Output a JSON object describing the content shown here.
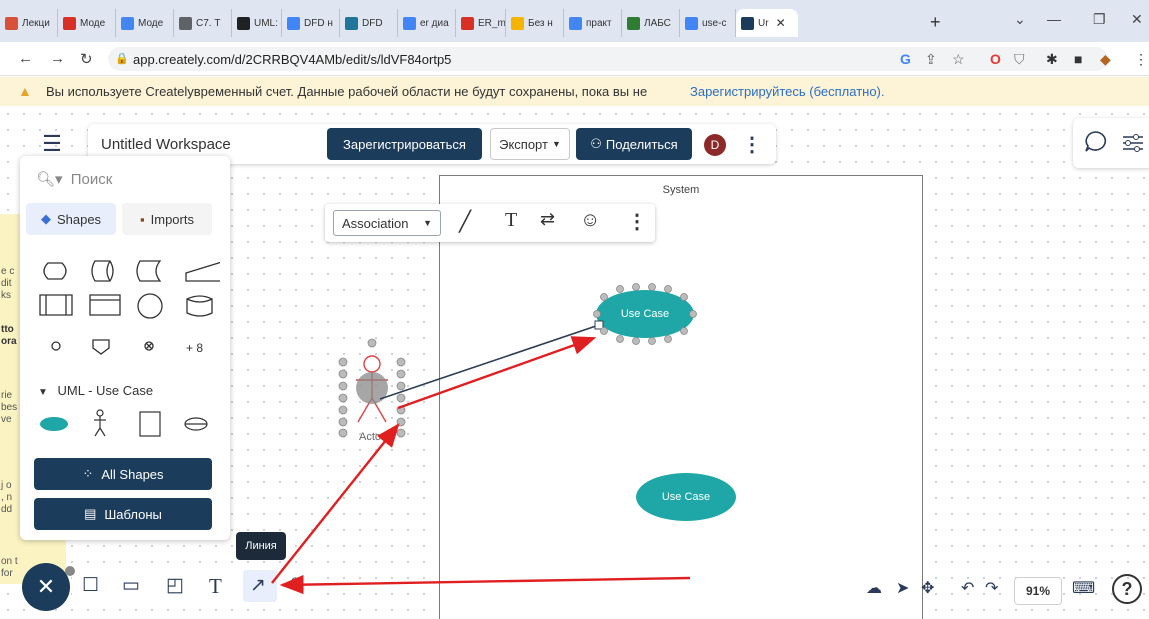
{
  "browser": {
    "tabs": [
      {
        "label": "Лекци",
        "icon": "red-diamond-icon",
        "color": "#d8523b"
      },
      {
        "label": "Моде",
        "icon": "pdf-icon",
        "color": "#d93025"
      },
      {
        "label": "Моде",
        "icon": "google-icon",
        "color": "#4285f4"
      },
      {
        "label": "С7. Т",
        "icon": "globe-icon",
        "color": "#5f6368"
      },
      {
        "label": "UML:",
        "icon": "app-icon",
        "color": "#202124"
      },
      {
        "label": "DFD н",
        "icon": "google-icon",
        "color": "#4285f4"
      },
      {
        "label": "DFD",
        "icon": "wordpress-icon",
        "color": "#21759b"
      },
      {
        "label": "er диа",
        "icon": "google-icon",
        "color": "#4285f4"
      },
      {
        "label": "ER_m",
        "icon": "pdf-icon",
        "color": "#d93025"
      },
      {
        "label": "Без н",
        "icon": "loading-icon",
        "color": "#f4b400"
      },
      {
        "label": "практ",
        "icon": "google-icon",
        "color": "#4285f4"
      },
      {
        "label": "ЛАБС",
        "icon": "doc-icon",
        "color": "#2f7d32"
      },
      {
        "label": "use-c",
        "icon": "google-icon",
        "color": "#4285f4"
      },
      {
        "label": "Ur",
        "icon": "creately-icon",
        "color": "#1c3c5c",
        "active": true
      }
    ],
    "url": "app.creately.com/d/2CRRBQV4AMb/edit/s/ldVF84ortp5"
  },
  "warning": {
    "message": "Вы используете Createlyвременный счет. Данные рабочей области не будут сохранены, пока вы не",
    "link": "Зарегистрируйтесь (бесплатно)."
  },
  "header": {
    "workspace_title": "Untitled Workspace",
    "register_label": "Зарегистрироваться",
    "export_label": "Экспорт",
    "share_label": "Поделиться",
    "avatar_letter": "D"
  },
  "panel": {
    "search_placeholder": "Поиск",
    "shapes_tab": "Shapes",
    "imports_tab": "Imports",
    "more_count": "+ 8",
    "uml_section": "UML - Use Case",
    "all_shapes": "All Shapes",
    "templates": "Шаблоны"
  },
  "diagram": {
    "system_label": "System",
    "use_case_1": "Use Case",
    "use_case_2": "Use Case",
    "actor_label": "Actor",
    "accent": "#1fa7a7",
    "annotation_color": "#e02020"
  },
  "connector_toolbar": {
    "line_type": "Association"
  },
  "left_strip_text": [
    "e c",
    "dit",
    "ks",
    "tto",
    "ora",
    "rie",
    "bes",
    "ve",
    "j o",
    ", n",
    "dd",
    "on t",
    "for"
  ],
  "bottom_toolbar": {
    "tooltip": "Линия"
  },
  "zoom": {
    "level": "91%"
  }
}
